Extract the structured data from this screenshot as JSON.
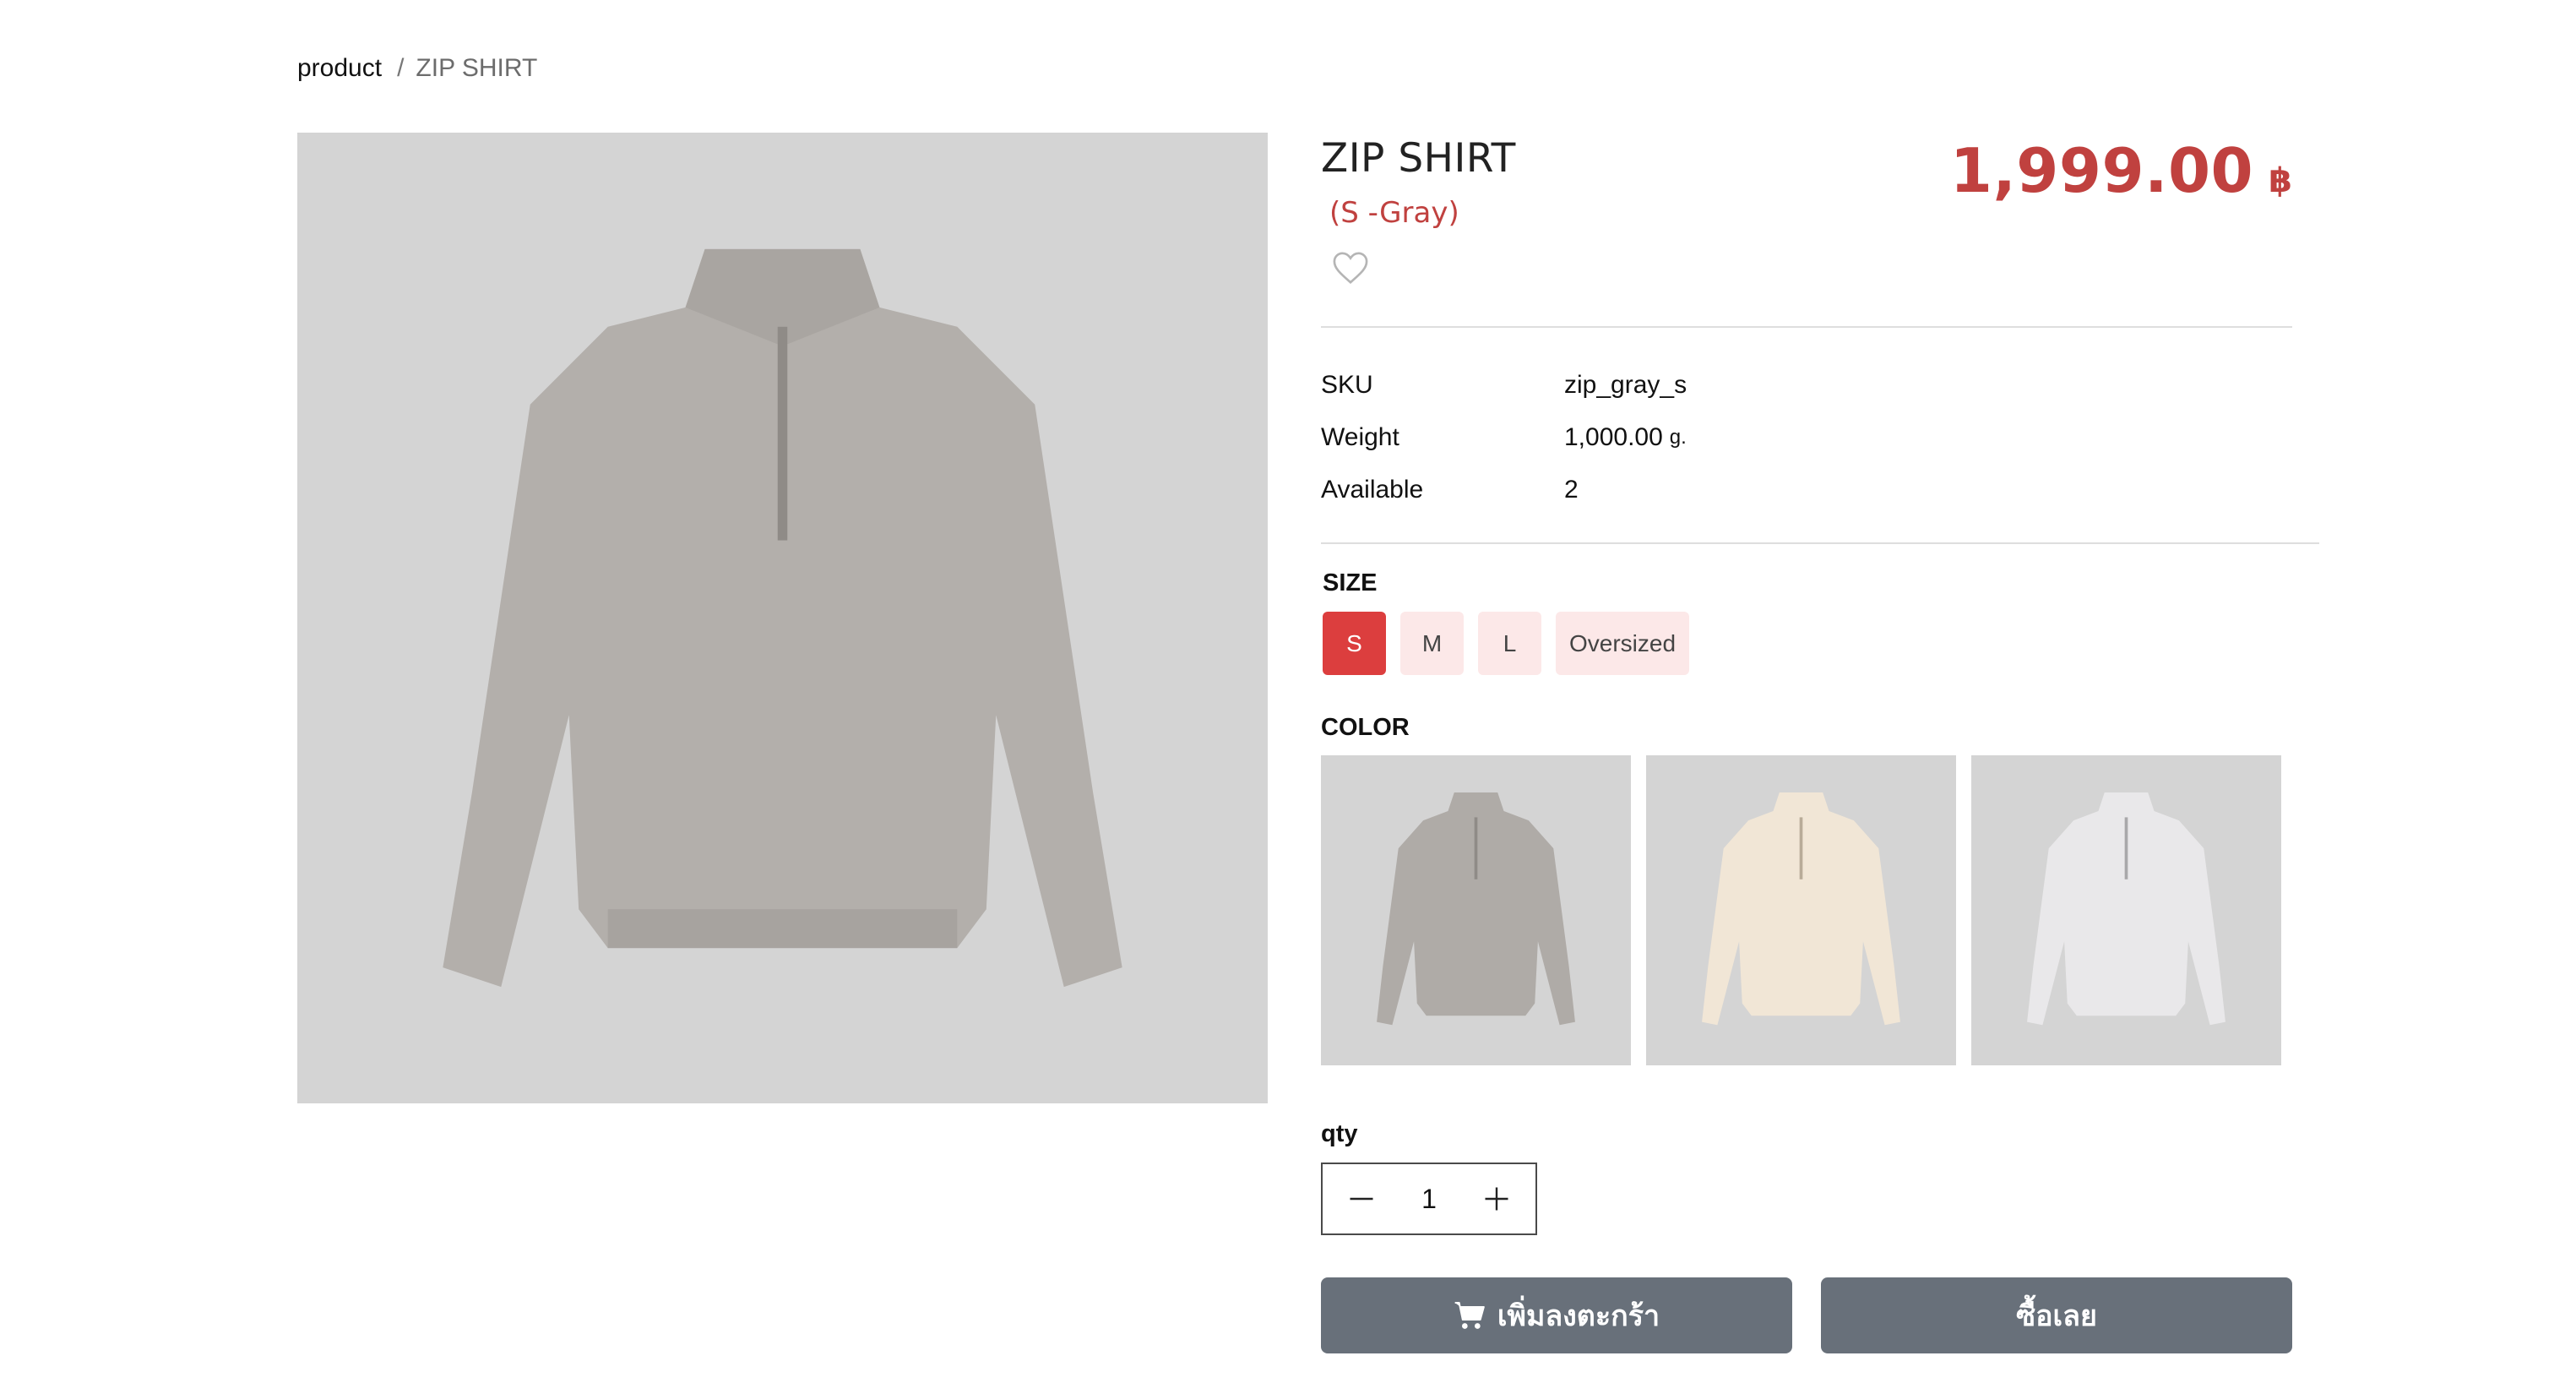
{
  "breadcrumb": {
    "root": "product",
    "separator": "/",
    "current": "ZIP SHIRT"
  },
  "product": {
    "title": "ZIP SHIRT",
    "variant": "(S -Gray)",
    "price": "1,999.00",
    "currency": "฿",
    "wishlist_icon": "heart-outline-icon"
  },
  "specs": [
    {
      "label": "SKU",
      "value": "zip_gray_s",
      "unit": ""
    },
    {
      "label": "Weight",
      "value": "1,000.00",
      "unit": "g."
    },
    {
      "label": "Available",
      "value": "2",
      "unit": ""
    }
  ],
  "size": {
    "label": "SIZE",
    "options": [
      "S",
      "M",
      "L",
      "Oversized"
    ],
    "selected": "S"
  },
  "color": {
    "label": "COLOR",
    "options": [
      "gray",
      "cream",
      "light-gray"
    ]
  },
  "qty": {
    "label": "qty",
    "value": "1"
  },
  "actions": {
    "add_to_cart": "เพิ่มลงตะกร้า",
    "buy_now": "ซื้อเลย"
  },
  "colors": {
    "accent_red": "#c0413f",
    "size_active": "#dc3e3e",
    "size_inactive": "#fce8e8",
    "button_gray": "#68707a",
    "image_bg": "#d4d4d4"
  }
}
